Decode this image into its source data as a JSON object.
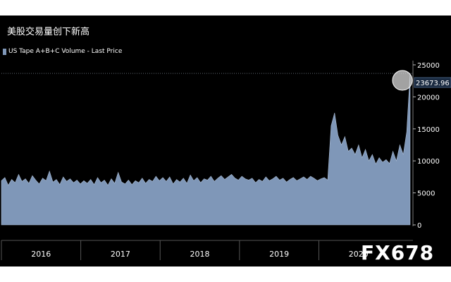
{
  "title": "美股交易量创下新高",
  "watermark": "FX678",
  "chart_data": {
    "type": "area",
    "series": [
      {
        "name": "US Tape A+B+C Volume - Last Price",
        "color": "#7f97b8",
        "values": [
          6900,
          7400,
          6200,
          7100,
          6600,
          7900,
          6800,
          7200,
          6500,
          7700,
          7000,
          6400,
          7300,
          6900,
          8400,
          6700,
          7100,
          6300,
          7500,
          6800,
          7200,
          6600,
          7000,
          6400,
          6900,
          6500,
          7100,
          6300,
          7400,
          6600,
          7000,
          6200,
          7200,
          6500,
          8200,
          6700,
          6400,
          7000,
          6300,
          6900,
          6600,
          7300,
          6500,
          7100,
          6800,
          7600,
          6900,
          7400,
          6800,
          7500,
          6400,
          7100,
          6700,
          7300,
          6500,
          7800,
          6900,
          7400,
          6600,
          7200,
          7000,
          7600,
          6800,
          7300,
          7700,
          7100,
          7500,
          7900,
          7300,
          7000,
          7600,
          7200,
          7000,
          7300,
          6600,
          7100,
          6800,
          7500,
          6900,
          7200,
          7600,
          7000,
          7300,
          6700,
          7100,
          7400,
          6900,
          7200,
          7500,
          7100,
          7600,
          7300,
          6900,
          7200,
          7400,
          7000,
          15500,
          17500,
          14000,
          12500,
          13800,
          11500,
          12000,
          11000,
          12500,
          10500,
          11800,
          10000,
          11000,
          9500,
          10500,
          9800,
          10200,
          9600,
          11500,
          10000,
          12500,
          11000,
          14500,
          23674
        ],
        "last_label": "23673.96"
      }
    ],
    "x_axis": {
      "labels": [
        "2016",
        "2017",
        "2018",
        "2019",
        "2020"
      ],
      "range": [
        2016,
        2021.15
      ]
    },
    "ylim": [
      0,
      25000
    ],
    "yticks": [
      0,
      5000,
      10000,
      15000,
      20000,
      25000
    ],
    "grid": false,
    "legend": "top-left"
  }
}
